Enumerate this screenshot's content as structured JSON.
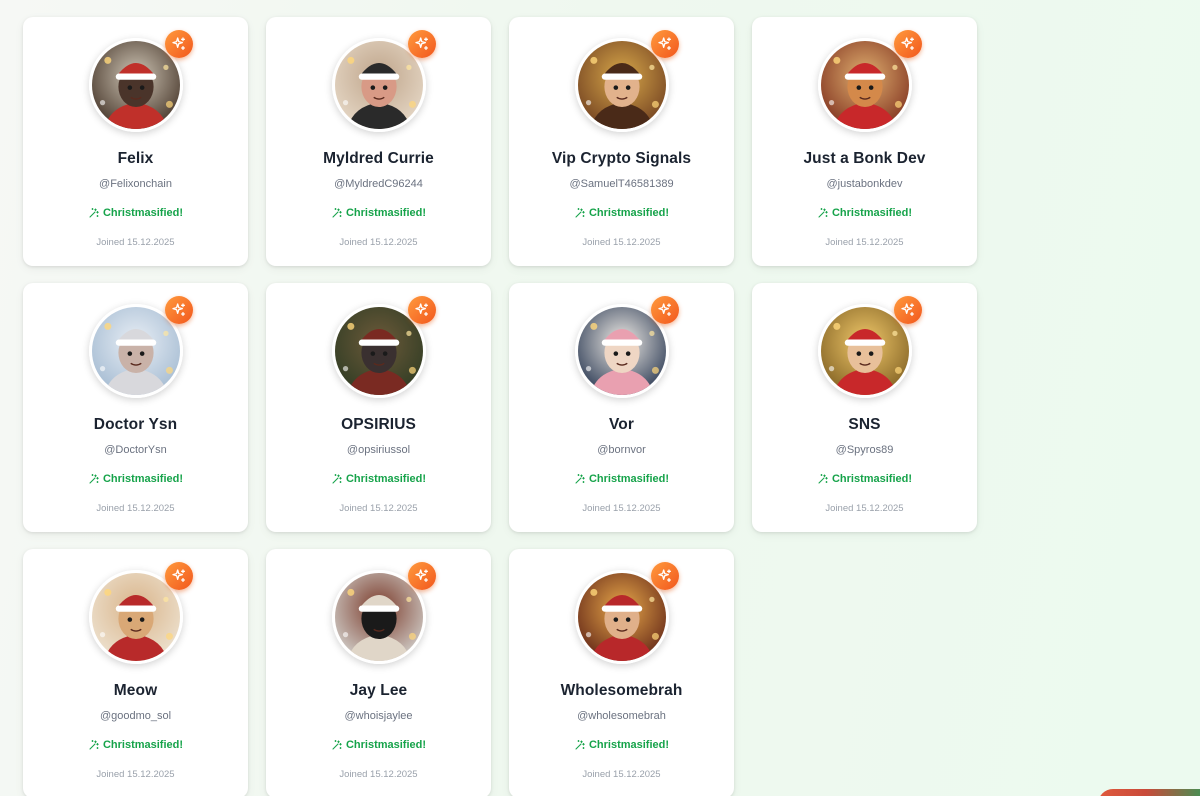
{
  "users": [
    {
      "name": "Felix",
      "handle": "@Felixonchain",
      "status": "Christmasified!",
      "joined": "Joined 15.12.2025",
      "bg1": "#3b2a1e",
      "bg2": "#cfc6b6",
      "face": "#4a342a",
      "hat": "#c0302a"
    },
    {
      "name": "Myldred Currie",
      "handle": "@MyldredC96244",
      "status": "Christmasified!",
      "joined": "Joined 15.12.2025",
      "bg1": "#e9dccb",
      "bg2": "#bfa58b",
      "face": "#d89a86",
      "hat": "#2a2a2a"
    },
    {
      "name": "Vip Crypto Signals",
      "handle": "@SamuelT46581389",
      "status": "Christmasified!",
      "joined": "Joined 15.12.2025",
      "bg1": "#6b3a1e",
      "bg2": "#d8a84a",
      "face": "#e2b28c",
      "hat": "#4a2a18"
    },
    {
      "name": "Just a Bonk Dev",
      "handle": "@justabonkdev",
      "status": "Christmasified!",
      "joined": "Joined 15.12.2025",
      "bg1": "#7a2a1a",
      "bg2": "#e0b070",
      "face": "#d4894a",
      "hat": "#c8282a"
    },
    {
      "name": "Doctor Ysn",
      "handle": "@DoctorYsn",
      "status": "Christmasified!",
      "joined": "Joined 15.12.2025",
      "bg1": "#9fb7cf",
      "bg2": "#e8eef5",
      "face": "#c9b2a8",
      "hat": "#d8d8dc"
    },
    {
      "name": "OPSIRIUS",
      "handle": "@opsiriussol",
      "status": "Christmasified!",
      "joined": "Joined 15.12.2025",
      "bg1": "#2b3a22",
      "bg2": "#6d5a3a",
      "face": "#3a3030",
      "hat": "#7a2a22"
    },
    {
      "name": "Vor",
      "handle": "@bornvor",
      "status": "Christmasified!",
      "joined": "Joined 15.12.2025",
      "bg1": "#1e2e4a",
      "bg2": "#f0ece6",
      "face": "#efd6c4",
      "hat": "#e9a0b0"
    },
    {
      "name": "SNS",
      "handle": "@Spyros89",
      "status": "Christmasified!",
      "joined": "Joined 15.12.2025",
      "bg1": "#7a5a1e",
      "bg2": "#f0c86a",
      "face": "#e8c09a",
      "hat": "#c8282a"
    },
    {
      "name": "Meow",
      "handle": "@goodmo_sol",
      "status": "Christmasified!",
      "joined": "Joined 15.12.2025",
      "bg1": "#efe6d6",
      "bg2": "#d9b48a",
      "face": "#d9a876",
      "hat": "#b82a2a"
    },
    {
      "name": "Jay Lee",
      "handle": "@whoisjaylee",
      "status": "Christmasified!",
      "joined": "Joined 15.12.2025",
      "bg1": "#d9dcd8",
      "bg2": "#7a3a2a",
      "face": "#1a1a1a",
      "hat": "#e0d6c8"
    },
    {
      "name": "Wholesomebrah",
      "handle": "@wholesomebrah",
      "status": "Christmasified!",
      "joined": "Joined 15.12.2025",
      "bg1": "#5a1e14",
      "bg2": "#e8a84a",
      "face": "#e0b08a",
      "hat": "#b8282a"
    }
  ],
  "badge_icon": "sparkles-icon",
  "status_icon": "wand-sparkles-icon",
  "colors": {
    "accent_orange": "#f2571d",
    "status_green": "#16a34a",
    "name_text": "#1b2330",
    "muted_text": "#6b7280"
  }
}
